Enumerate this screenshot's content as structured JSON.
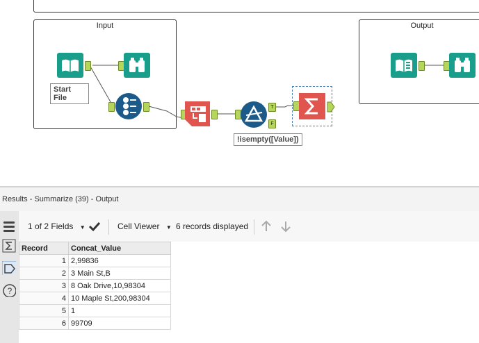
{
  "canvas": {
    "containers": [
      {
        "title": "Input"
      },
      {
        "title": "Output"
      }
    ],
    "annotations": {
      "start_file": "Start File",
      "filter_expr": "!isempty([Value])"
    },
    "filter_anchors": {
      "true_label": "T",
      "false_label": "F"
    }
  },
  "results": {
    "title": "Results - Summarize (39) - Output",
    "toolbar": {
      "fields_label": "1 of 2 Fields",
      "viewer_label": "Cell Viewer",
      "records_label": "6 records displayed"
    },
    "table": {
      "columns": [
        "Record",
        "Concat_Value"
      ],
      "rows": [
        {
          "record": "1",
          "value": "2,99836"
        },
        {
          "record": "2",
          "value": "3 Main St,B"
        },
        {
          "record": "3",
          "value": "8 Oak Drive,10,98304"
        },
        {
          "record": "4",
          "value": "10 Maple St,200,98304"
        },
        {
          "record": "5",
          "value": "1"
        },
        {
          "record": "6",
          "value": "99709"
        }
      ]
    }
  },
  "colors": {
    "input_tool": "#1a9e8c",
    "browse_tool": "#1a9e8c",
    "record_id_tool": "#1c5a8a",
    "text_to_cols_tool": "#e0564e",
    "filter_tool": "#1c5a8a",
    "summarize_tool": "#e0564e",
    "anchor": "#b5d65a"
  }
}
